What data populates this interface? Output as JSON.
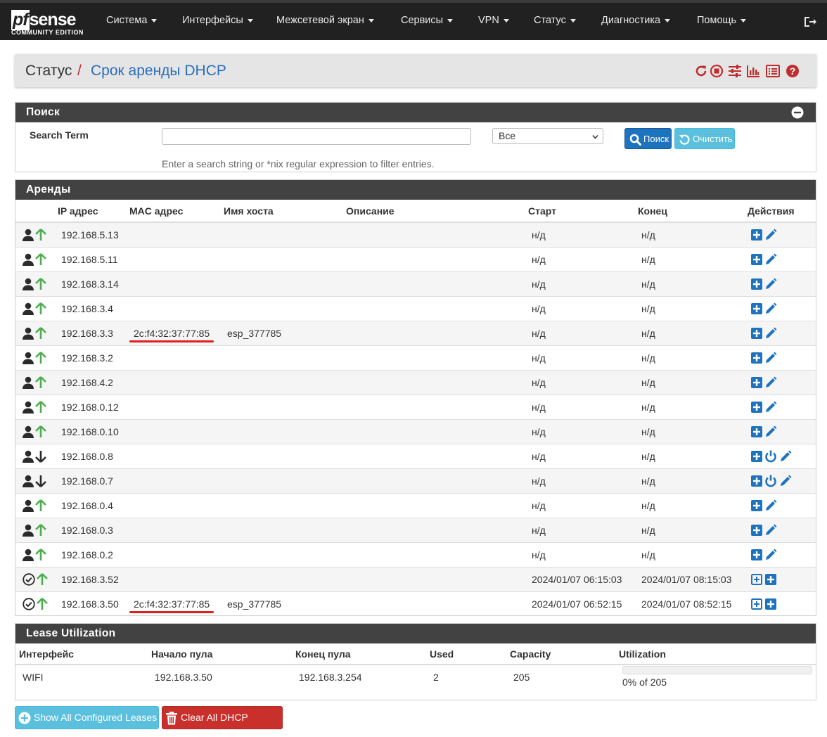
{
  "brand": {
    "logo_main": "sense",
    "logo_prefix": "pf",
    "logo_sub": "COMMUNITY EDITION"
  },
  "nav": {
    "items": [
      {
        "label": "Система"
      },
      {
        "label": "Интерфейсы"
      },
      {
        "label": "Межсетевой экран"
      },
      {
        "label": "Сервисы"
      },
      {
        "label": "VPN"
      },
      {
        "label": "Статус"
      },
      {
        "label": "Диагностика"
      },
      {
        "label": "Помощь"
      }
    ]
  },
  "breadcrumb": {
    "section": "Статус",
    "separator": "/",
    "page": "Срок аренды DHCP"
  },
  "search": {
    "title": "Поиск",
    "label": "Search Term",
    "value": "",
    "placeholder": "",
    "select_value": "Все",
    "search_button": "Поиск",
    "clear_button": "Очистить",
    "help": "Enter a search string or *nix regular expression to filter entries."
  },
  "leases": {
    "title": "Аренды",
    "columns": [
      "IP адрес",
      "MAC адрес",
      "Имя хоста",
      "Описание",
      "Старт",
      "Конец",
      "Действия"
    ],
    "rows": [
      {
        "status": "user",
        "online": "up",
        "ip": "192.168.5.13",
        "mac": "",
        "host": "",
        "desc": "",
        "start": "н/д",
        "end": "н/д",
        "actions": "static"
      },
      {
        "status": "user",
        "online": "up",
        "ip": "192.168.5.11",
        "mac": "",
        "host": "",
        "desc": "",
        "start": "н/д",
        "end": "н/д",
        "actions": "static"
      },
      {
        "status": "user",
        "online": "up",
        "ip": "192.168.3.14",
        "mac": "",
        "host": "",
        "desc": "",
        "start": "н/д",
        "end": "н/д",
        "actions": "static"
      },
      {
        "status": "user",
        "online": "up",
        "ip": "192.168.3.4",
        "mac": "",
        "host": "",
        "desc": "",
        "start": "н/д",
        "end": "н/д",
        "actions": "static"
      },
      {
        "status": "user",
        "online": "up",
        "ip": "192.168.3.3",
        "mac": "2c:f4:32:37:77:85",
        "host": "esp_377785",
        "desc": "",
        "start": "н/д",
        "end": "н/д",
        "actions": "static",
        "highlight": true
      },
      {
        "status": "user",
        "online": "up",
        "ip": "192.168.3.2",
        "mac": "",
        "host": "",
        "desc": "",
        "start": "н/д",
        "end": "н/д",
        "actions": "static"
      },
      {
        "status": "user",
        "online": "up",
        "ip": "192.168.4.2",
        "mac": "",
        "host": "",
        "desc": "",
        "start": "н/д",
        "end": "н/д",
        "actions": "static"
      },
      {
        "status": "user",
        "online": "up",
        "ip": "192.168.0.12",
        "mac": "",
        "host": "",
        "desc": "",
        "start": "н/д",
        "end": "н/д",
        "actions": "static"
      },
      {
        "status": "user",
        "online": "up",
        "ip": "192.168.0.10",
        "mac": "",
        "host": "",
        "desc": "",
        "start": "н/д",
        "end": "н/д",
        "actions": "static"
      },
      {
        "status": "user",
        "online": "down",
        "ip": "192.168.0.8",
        "mac": "",
        "host": "",
        "desc": "",
        "start": "н/д",
        "end": "н/д",
        "actions": "wol"
      },
      {
        "status": "user",
        "online": "down",
        "ip": "192.168.0.7",
        "mac": "",
        "host": "",
        "desc": "",
        "start": "н/д",
        "end": "н/д",
        "actions": "wol"
      },
      {
        "status": "user",
        "online": "up",
        "ip": "192.168.0.4",
        "mac": "",
        "host": "",
        "desc": "",
        "start": "н/д",
        "end": "н/д",
        "actions": "static"
      },
      {
        "status": "user",
        "online": "up",
        "ip": "192.168.0.3",
        "mac": "",
        "host": "",
        "desc": "",
        "start": "н/д",
        "end": "н/д",
        "actions": "static"
      },
      {
        "status": "user",
        "online": "up",
        "ip": "192.168.0.2",
        "mac": "",
        "host": "",
        "desc": "",
        "start": "н/д",
        "end": "н/д",
        "actions": "static"
      },
      {
        "status": "active",
        "online": "up",
        "ip": "192.168.3.52",
        "mac": "",
        "host": "",
        "desc": "",
        "start": "2024/01/07 06:15:03",
        "end": "2024/01/07 08:15:03",
        "actions": "dynamic"
      },
      {
        "status": "active",
        "online": "up",
        "ip": "192.168.3.50",
        "mac": "2c:f4:32:37:77:85",
        "host": "esp_377785",
        "desc": "",
        "start": "2024/01/07 06:52:15",
        "end": "2024/01/07 08:52:15",
        "actions": "dynamic",
        "highlight": true
      }
    ]
  },
  "utilization": {
    "title": "Lease Utilization",
    "columns": [
      "Интерфейс",
      "Начало пула",
      "Конец пула",
      "Used",
      "Capacity",
      "Utilization"
    ],
    "row": {
      "iface": "WIFI",
      "start": "192.168.3.50",
      "end": "192.168.3.254",
      "used": "2",
      "capacity": "205",
      "util_text": "0% of 205",
      "util_fraction": 0.0
    }
  },
  "footer_buttons": {
    "show_all": "Show All Configured Leases",
    "clear_all": "Clear All DHCP Leases"
  },
  "colors": {
    "accent": "#1e73be",
    "info": "#5bc0de",
    "danger": "#c9302c",
    "online": "#4cae4c",
    "header": "#424242",
    "nav": "#212121"
  }
}
